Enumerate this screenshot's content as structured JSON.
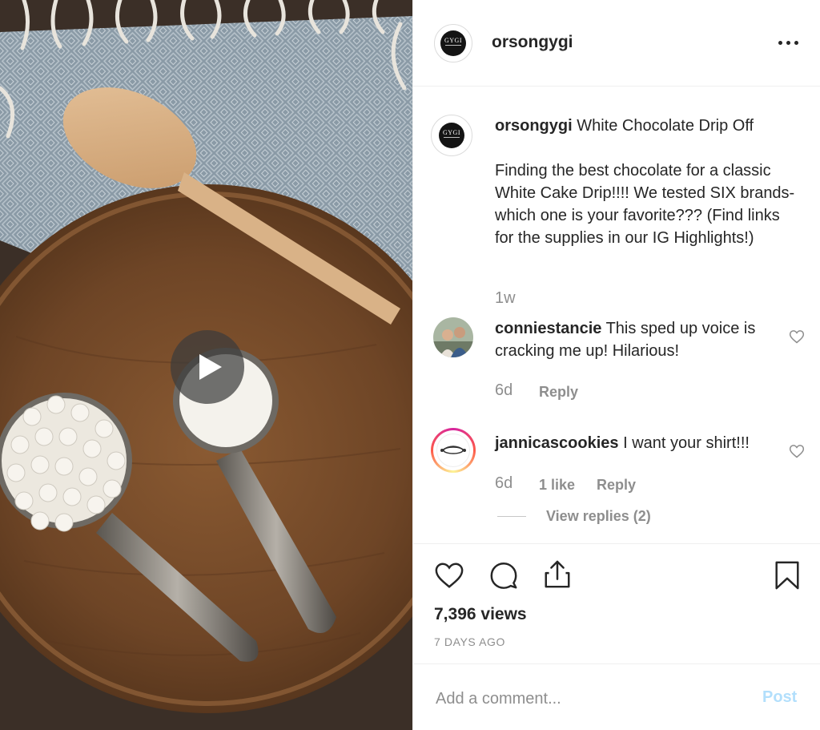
{
  "post": {
    "username": "orsongygi",
    "avatar_brand": "GYGI",
    "caption_title": "White Chocolate Drip Off",
    "caption_body": "Finding the best chocolate for a classic White Cake Drip!!!! We tested SIX brands- which one is your favorite??? (Find links for the supplies in our IG Highlights!)",
    "caption_age": "1w"
  },
  "comments": [
    {
      "username": "conniestancie",
      "text": "This sped up voice is cracking me up! Hilarious!",
      "age": "6d",
      "reply_label": "Reply"
    },
    {
      "username": "jannicascookies",
      "text": "I want your shirt!!!",
      "age": "6d",
      "likes": "1 like",
      "reply_label": "Reply",
      "view_replies": "View replies (2)"
    }
  ],
  "stats": {
    "views": "7,396 views",
    "posted": "7 DAYS AGO"
  },
  "composer": {
    "placeholder": "Add a comment...",
    "post_label": "Post"
  },
  "colors": {
    "text": "#262626",
    "muted": "#8e8e8e",
    "post_disabled": "#b2dffc",
    "divider": "#efefef"
  },
  "icons": {
    "media_play": "play-icon",
    "more": "more-options-icon",
    "like": "heart-icon",
    "comment": "comment-icon",
    "share": "share-icon",
    "save": "bookmark-icon"
  }
}
